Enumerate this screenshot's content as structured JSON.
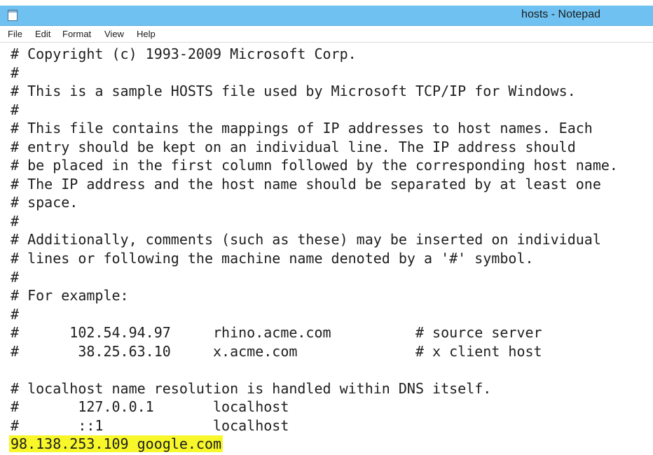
{
  "window": {
    "title": "hosts - Notepad"
  },
  "menu": {
    "file": "File",
    "edit": "Edit",
    "format": "Format",
    "view": "View",
    "help": "Help"
  },
  "editor": {
    "lines": [
      "# Copyright (c) 1993-2009 Microsoft Corp.",
      "#",
      "# This is a sample HOSTS file used by Microsoft TCP/IP for Windows.",
      "#",
      "# This file contains the mappings of IP addresses to host names. Each",
      "# entry should be kept on an individual line. The IP address should",
      "# be placed in the first column followed by the corresponding host name.",
      "# The IP address and the host name should be separated by at least one",
      "# space.",
      "#",
      "# Additionally, comments (such as these) may be inserted on individual",
      "# lines or following the machine name denoted by a '#' symbol.",
      "#",
      "# For example:",
      "#",
      "#      102.54.94.97     rhino.acme.com          # source server",
      "#       38.25.63.10     x.acme.com              # x client host",
      "",
      "# localhost name resolution is handled within DNS itself.",
      "#       127.0.0.1       localhost",
      "#       ::1             localhost"
    ],
    "highlighted_line": "98.138.253.109 google.com",
    "highlight_color": "#f7f72a"
  }
}
